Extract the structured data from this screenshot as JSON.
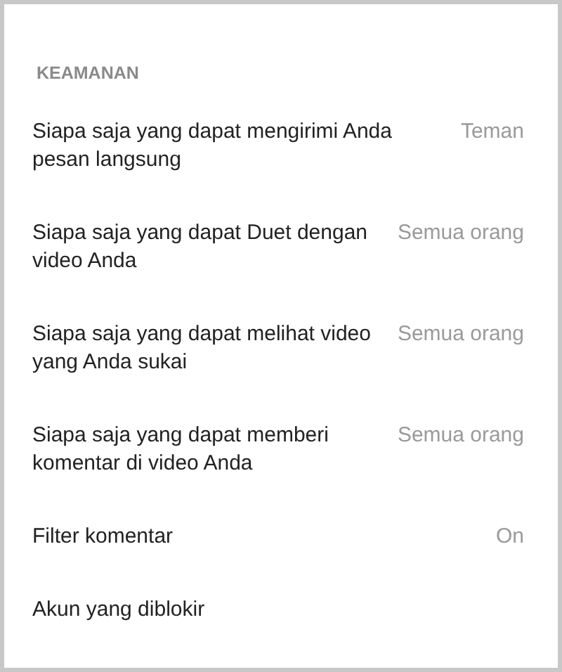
{
  "section": {
    "title": "KEAMANAN"
  },
  "rows": [
    {
      "label": "Siapa saja yang dapat mengirimi Anda pesan langsung",
      "value": "Teman"
    },
    {
      "label": "Siapa saja yang dapat Duet dengan video Anda",
      "value": "Semua orang"
    },
    {
      "label": "Siapa saja yang dapat melihat video yang Anda sukai",
      "value": "Semua orang"
    },
    {
      "label": "Siapa saja yang dapat memberi komentar di video Anda",
      "value": "Semua orang"
    },
    {
      "label": "Filter komentar",
      "value": "On"
    },
    {
      "label": "Akun yang diblokir"
    }
  ]
}
